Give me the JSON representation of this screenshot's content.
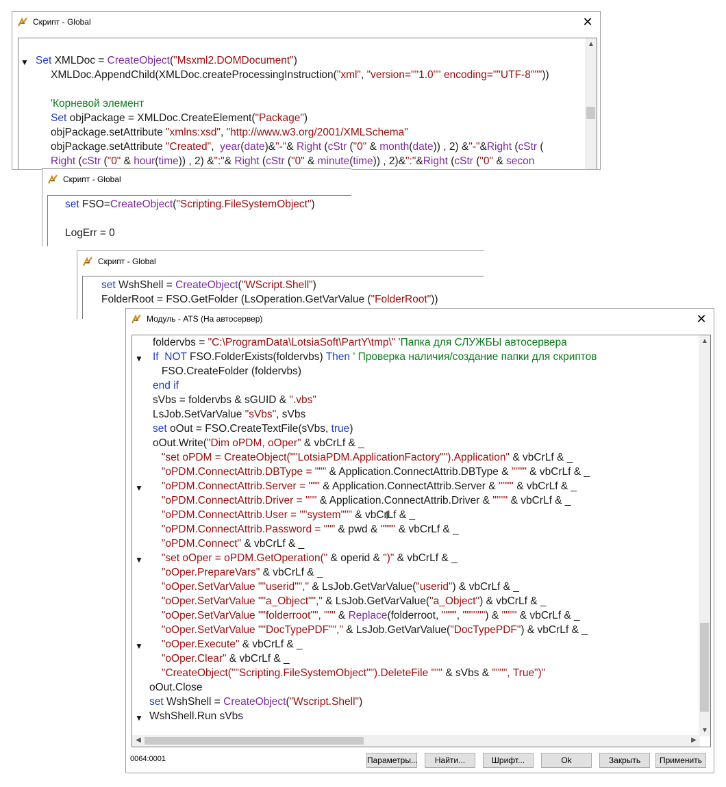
{
  "windows": {
    "w1": {
      "title": "Скрипт - Global"
    },
    "w2": {
      "title": "Скрипт - Global"
    },
    "w3": {
      "title": "Скрипт - Global"
    },
    "w4": {
      "title": "Модуль - ATS (На автосервер)"
    }
  },
  "icons": {
    "app": "script-app-icon",
    "close": "close-icon",
    "fold": "fold-arrow-icon"
  },
  "colors": {
    "keyword": "#1d3fb3",
    "function": "#7a2b9c",
    "string": "#9a0d0d",
    "comment": "#0a7a1c"
  },
  "w1_code": [
    [
      "Set",
      " XMLDoc = ",
      "CreateObject",
      "(",
      "\"Msxml2.DOMDocument\"",
      ")"
    ],
    [
      "XMLDoc.AppendChild(XMLDoc.createProcessingInstruction(",
      "\"xml\"",
      ", ",
      "\"version=\"\"1.0\"\" encoding=\"\"UTF-8\"\"\"",
      "))"
    ],
    [
      ""
    ],
    [
      "'Корневой элемент"
    ],
    [
      "Set",
      " objPackage = XMLDoc.CreateElement(",
      "\"Package\"",
      ")"
    ],
    [
      "objPackage.setAttribute ",
      "\"xmlns:xsd\"",
      ", ",
      "\"http://www.w3.org/2001/XMLSchema\""
    ],
    [
      "objPackage.setAttribute ",
      "\"Created\"",
      ",  ",
      "year",
      "(",
      "date",
      ")&",
      "\"-\"",
      "& ",
      "Right",
      " (",
      "cStr",
      " (",
      "\"0\"",
      " & ",
      "month",
      "(",
      "date",
      ")) , 2) &",
      "\"-\"",
      "&",
      "Right",
      " (",
      "cStr",
      " ("
    ],
    [
      "Right",
      " (",
      "cStr",
      " (",
      "\"0\"",
      " & ",
      "hour",
      "(",
      "time",
      ")) , 2) &",
      "\":\"",
      "& ",
      "Right",
      " (",
      "cStr",
      " (",
      "\"0\"",
      " & ",
      "minute",
      "(",
      "time",
      ")) , 2)&",
      "\":\"",
      "&",
      "Right",
      " (",
      "cStr",
      " (",
      "\"0\"",
      " & ",
      "secon"
    ]
  ],
  "w2_code": [
    [
      "set",
      " FSO=",
      "CreateObject",
      "(",
      "\"Scripting.FileSystemObject\"",
      ")"
    ],
    [
      ""
    ],
    [
      "LogErr = 0"
    ]
  ],
  "w3_code": [
    [
      "set",
      " WshShell = ",
      "CreateObject",
      "(",
      "\"WScript.Shell\"",
      ")"
    ],
    [
      "FolderRoot = FSO.GetFolder (LsOperation.GetVarValue (",
      "\"FolderRoot\"",
      "))"
    ]
  ],
  "w4_code": [
    [
      "foldervbs = ",
      "\"C:\\ProgramData\\LotsiaSoft\\PartY\\tmp\\\"",
      " ",
      "'Папка для СЛУЖБЫ автосервера"
    ],
    [
      "If",
      "  ",
      "NOT",
      " FSO.FolderExists(foldervbs) ",
      "Then",
      " ",
      "' Проверка наличия/создание папки для скриптов"
    ],
    [
      "   FSO.CreateFolder (foldervbs)"
    ],
    [
      "end if"
    ],
    [
      "sVbs = foldervbs & sGUID & ",
      "\".vbs\""
    ],
    [
      "LsJob.SetVarValue ",
      "\"sVbs\"",
      ", sVbs"
    ],
    [
      "set",
      " oOut = FSO.CreateTextFile(sVbs, ",
      "true",
      ")"
    ],
    [
      "oOut.Write(",
      "\"Dim oPDM, oOper\"",
      " & vbCrLf & _"
    ],
    [
      "   ",
      "\"set oPDM = CreateObject(\"\"LotsiaPDM.ApplicationFactory\"\").Application\"",
      " & vbCrLf & _"
    ],
    [
      "   ",
      "\"oPDM.ConnectAttrib.DBType = \"\"\"",
      " & Application.ConnectAttrib.DBType & ",
      "\"\"\"\"",
      " & vbCrLf & _"
    ],
    [
      "   ",
      "\"oPDM.ConnectAttrib.Server = \"\"\"",
      " & Application.ConnectAttrib.Server & ",
      "\"\"\"\"",
      " & vbCrLf & _"
    ],
    [
      "   ",
      "\"oPDM.ConnectAttrib.Driver = \"\"\"",
      " & Application.ConnectAttrib.Driver & ",
      "\"\"\"\"",
      " & vbCrLf & _"
    ],
    [
      "   ",
      "\"oPDM.ConnectAttrib.User = \"\"system\"\"\"",
      " & vbCrLf & _"
    ],
    [
      "   ",
      "\"oPDM.ConnectAttrib.Password = \"\"\"",
      " & pwd & ",
      "\"\"\"\"",
      " & vbCrLf & _"
    ],
    [
      "   ",
      "\"oPDM.Connect\"",
      " & vbCrLf & _"
    ],
    [
      "   ",
      "\"set oOper = oPDM.GetOperation(\"",
      " & operid & ",
      "\")\"",
      " & vbCrLf & _"
    ],
    [
      "   ",
      "\"oOper.PrepareVars\"",
      " & vbCrLf & _"
    ],
    [
      "   ",
      "\"oOper.SetVarValue \"\"userid\"\",\"",
      " & LsJob.GetVarValue(",
      "\"userid\"",
      ") & vbCrLf & _"
    ],
    [
      "   ",
      "\"oOper.SetVarValue \"\"a_Object\"\",\"",
      " & LsJob.GetVarValue(",
      "\"a_Object\"",
      ") & vbCrLf & _"
    ],
    [
      "   ",
      "\"oOper.SetVarValue \"\"folderroot\"\", \"\"\"",
      " & ",
      "Replace",
      "(folderroot, ",
      "\"\"\"\"",
      ", ",
      "\"\"\"\"\"\"",
      ") & ",
      "\"\"\"\"",
      " & vbCrLf & _"
    ],
    [
      "   ",
      "\"oOper.SetVarValue \"\"DocTypePDF\"\",\"",
      " & LsJob.GetVarValue(",
      "\"DocTypePDF\"",
      ") & vbCrLf & _"
    ],
    [
      "   ",
      "\"oOper.Execute\"",
      " & vbCrLf & _"
    ],
    [
      "   ",
      "\"oOper.Clear\"",
      " & vbCrLf & _"
    ],
    [
      "   ",
      "\"CreateObject(\"\"Scripting.FileSystemObject\"\").DeleteFile \"\"\"",
      " & sVbs & ",
      "\"\"\"\", True\")\""
    ],
    [
      "oOut.Close"
    ],
    [
      "set",
      " WshShell = ",
      "CreateObject",
      "(",
      "\"Wscript.Shell\"",
      ")"
    ],
    [
      "WshShell.Run sVbs"
    ]
  ],
  "status": {
    "position": "0064:0001"
  },
  "buttons": {
    "params": "Параметры...",
    "find": "Найти...",
    "font": "Шрифт...",
    "ok": "Ok",
    "close": "Закрыть",
    "apply": "Применить"
  }
}
